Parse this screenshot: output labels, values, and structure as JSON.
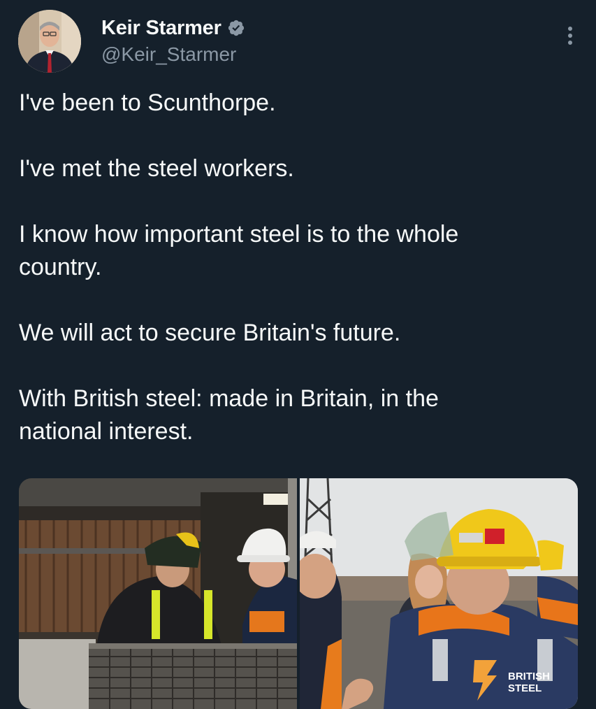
{
  "author": {
    "display_name": "Keir Starmer",
    "handle": "@Keir_Starmer",
    "verified_icon": "verified-badge-icon"
  },
  "menu_icon": "more-options-icon",
  "tweet": {
    "paragraphs": [
      "I've been to Scunthorpe.",
      "I've met the steel workers.",
      "I know how important steel is to the whole country.",
      "We will act to secure Britain's future.",
      "With British steel: made in Britain, in the national interest."
    ]
  },
  "media": {
    "photo_right_logo": "BRITISH STEEL"
  },
  "colors": {
    "background": "#15202b",
    "text_primary": "#f7f9f9",
    "text_secondary": "#8b98a5",
    "verified": "#8b98a5"
  }
}
